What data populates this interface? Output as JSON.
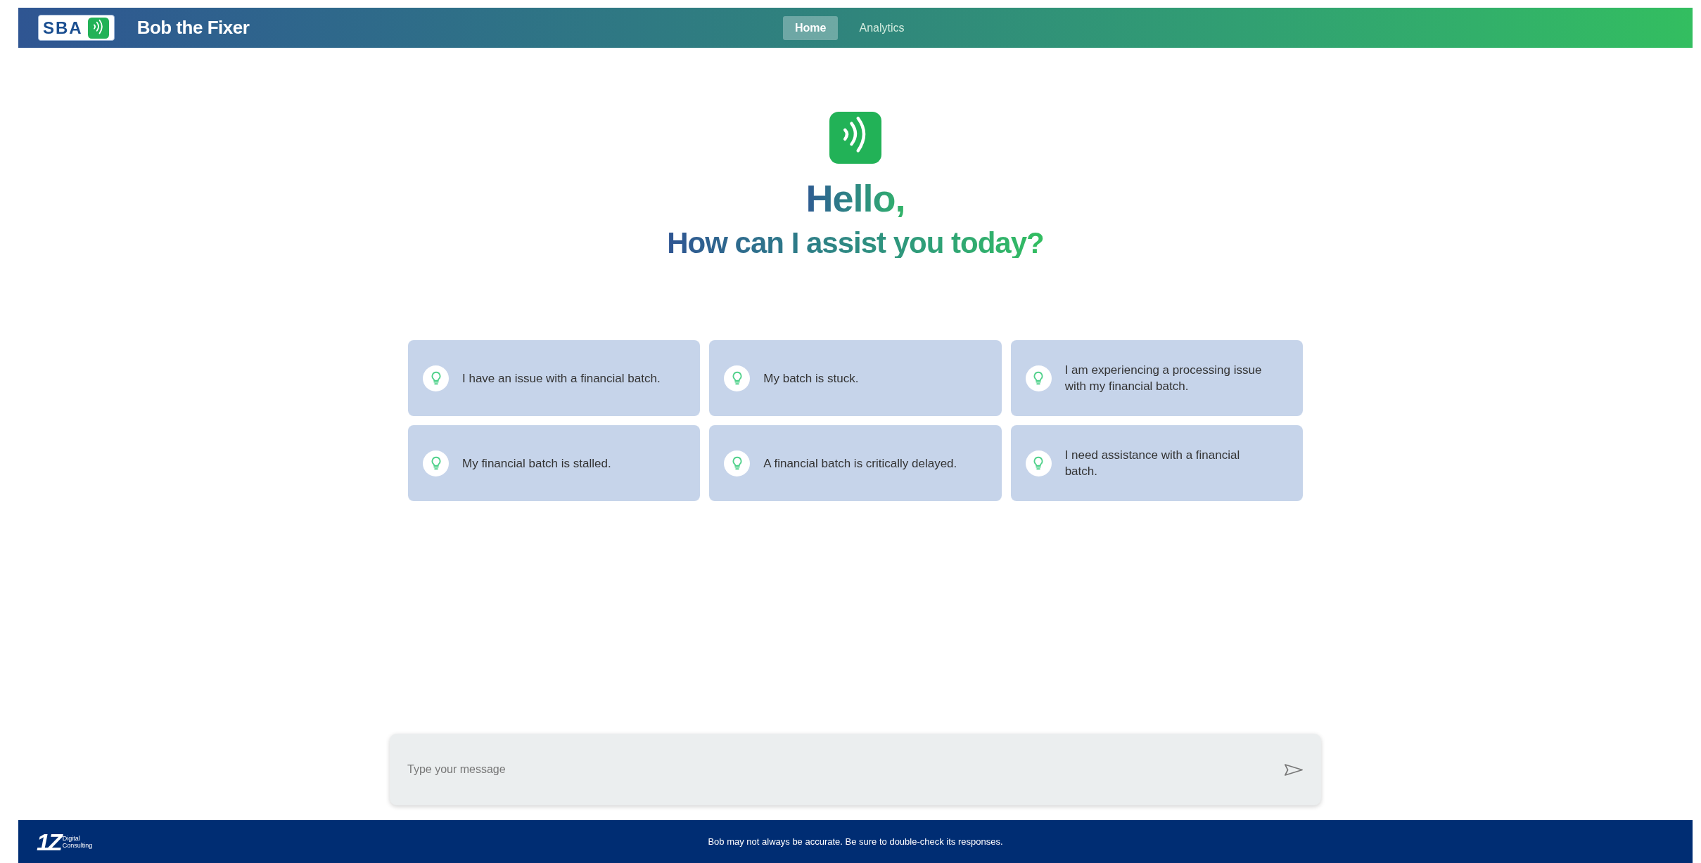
{
  "header": {
    "logo_text": "SBA",
    "title": "Bob the Fixer",
    "nav": [
      {
        "label": "Home",
        "selected": true
      },
      {
        "label": "Analytics",
        "selected": false
      }
    ]
  },
  "hero": {
    "greeting": "Hello,",
    "subtitle": "How can I assist you today?"
  },
  "suggestions": [
    {
      "text": "I have an issue with a financial batch."
    },
    {
      "text": "My batch is stuck."
    },
    {
      "text": "I am experiencing a processing issue with my financial batch."
    },
    {
      "text": "My financial batch is stalled."
    },
    {
      "text": "A financial batch is critically delayed."
    },
    {
      "text": "I need assistance with a financial batch."
    }
  ],
  "composer": {
    "placeholder": "Type your message"
  },
  "footer": {
    "logo_mark": "1Z",
    "logo_text": "Digital Consulting",
    "disclaimer": "Bob may not always be accurate. Be sure to double-check its responses."
  }
}
